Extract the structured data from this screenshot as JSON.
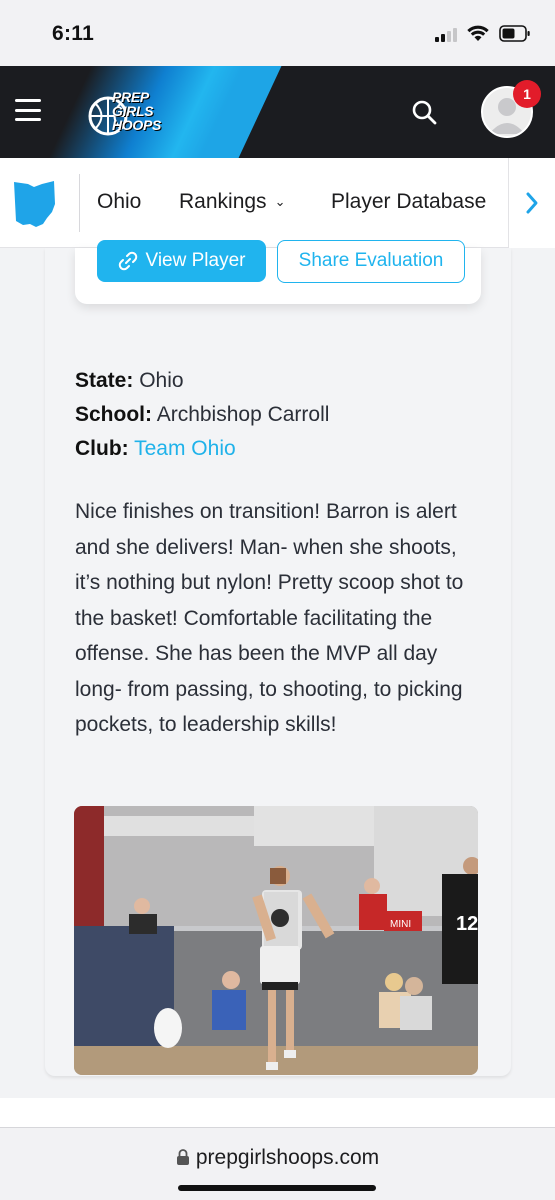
{
  "status_bar": {
    "time": "6:11"
  },
  "header": {
    "logo_text": [
      "PREP",
      "GIRLS",
      "HOOPS"
    ],
    "notification_count": "1",
    "brand_color": "#20b4ee"
  },
  "nav": {
    "items": [
      {
        "label": "Ohio"
      },
      {
        "label": "Rankings"
      },
      {
        "label": "Player Database"
      }
    ]
  },
  "actions": {
    "view_player": "View Player",
    "share_evaluation": "Share Evaluation"
  },
  "player": {
    "state_label": "State:",
    "state_value": "Ohio",
    "school_label": "School:",
    "school_value": "Archbishop Carroll",
    "club_label": "Club:",
    "club_value": "Team Ohio"
  },
  "evaluation": {
    "text": "Nice finishes on transition!  Barron is alert and she delivers!  Man- when she shoots, it’s nothing but nylon! Pretty scoop shot to the basket! Comfortable facilitating the offense. She has been the MVP all day long- from passing, to shooting, to picking pockets, to leadership skills!"
  },
  "photo": {
    "jersey_number": "12",
    "shirt_label": "MINI"
  },
  "browser": {
    "url": "prepgirlshoops.com"
  }
}
